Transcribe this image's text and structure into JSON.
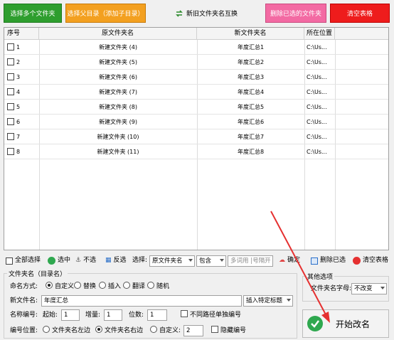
{
  "top_buttons": {
    "add_folders": "选择多个文件夹",
    "select_parent": "选择父目录（添加子目录）",
    "swap_names": "新旧文件夹名互换",
    "delete_selected": "删除已选的文件夹",
    "clear_table": "清空表格"
  },
  "table": {
    "headers": [
      "序号",
      "原文件夹名",
      "新文件夹名",
      "所在位置"
    ],
    "rows": [
      {
        "no": "1",
        "old": "新建文件夹 (4)",
        "new": "年度汇总1",
        "loc": "C:\\Us..."
      },
      {
        "no": "2",
        "old": "新建文件夹 (5)",
        "new": "年度汇总2",
        "loc": "C:\\Us..."
      },
      {
        "no": "3",
        "old": "新建文件夹 (6)",
        "new": "年度汇总3",
        "loc": "C:\\Us..."
      },
      {
        "no": "4",
        "old": "新建文件夹 (7)",
        "new": "年度汇总4",
        "loc": "C:\\Us..."
      },
      {
        "no": "5",
        "old": "新建文件夹 (8)",
        "new": "年度汇总5",
        "loc": "C:\\Us..."
      },
      {
        "no": "6",
        "old": "新建文件夹 (9)",
        "new": "年度汇总6",
        "loc": "C:\\Us..."
      },
      {
        "no": "7",
        "old": "新建文件夹 (10)",
        "new": "年度汇总7",
        "loc": "C:\\Us..."
      },
      {
        "no": "8",
        "old": "新建文件夹 (11)",
        "new": "年度汇总8",
        "loc": "C:\\Us..."
      }
    ]
  },
  "toolbar": {
    "select_all": "全部选择",
    "check": "选中",
    "uncheck": "不选",
    "invert": "反选",
    "select_label": "选择:",
    "field_value": "原文件夹名",
    "match_value": "包含",
    "filter_placeholder": "多词用 |号隔开",
    "confirm": "确定",
    "delete_selected": "删除已选",
    "clear_table": "清空表格"
  },
  "naming": {
    "group_title": "文件夹名（目录名）",
    "method_label": "命名方式:",
    "methods": [
      "自定义",
      "替换",
      "插入",
      "翻译",
      "随机"
    ],
    "new_name_label": "新文件名:",
    "new_name_value": "年度汇总",
    "insert_title": "插入特定标题",
    "numbering_label": "名称编号:",
    "start_label": "起始:",
    "start_value": "1",
    "step_label": "增量:",
    "step_value": "1",
    "digits_label": "位数:",
    "digits_value": "1",
    "no_path_number": "不同路径单独编号",
    "position_label": "编号位置:",
    "pos_left": "文件夹名左边",
    "pos_right": "文件夹名右边",
    "pos_custom": "自定义:",
    "custom_value": "2",
    "hide_number": "隐藏编号"
  },
  "other": {
    "group_title": "其他选项",
    "case_label": "文件夹名字母:",
    "case_value": "不改变"
  },
  "start_button": "开始改名",
  "colors": {
    "green": "#2e9e2e",
    "orange": "#f3a020",
    "pink": "#f36aa3",
    "red": "#ee1c1c",
    "arrow": "#e53030"
  }
}
